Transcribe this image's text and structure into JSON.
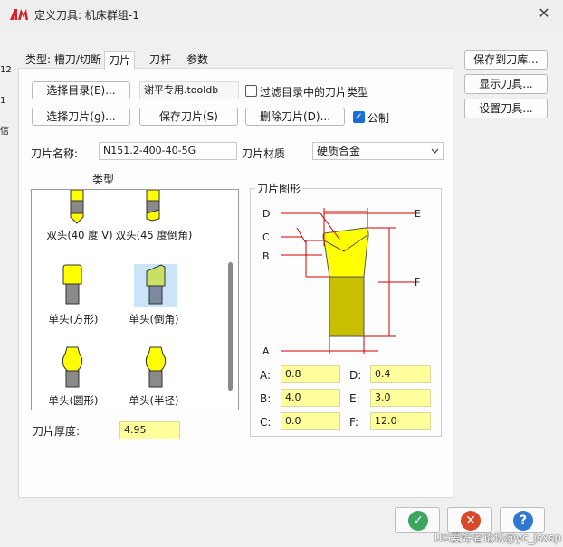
{
  "window": {
    "title": "定义刀具: 机床群组-1",
    "close_glyph": "✕"
  },
  "tabs": [
    {
      "label": "类型: 槽刀/切断",
      "active": false
    },
    {
      "label": "刀片",
      "active": true
    },
    {
      "label": "刀杆",
      "active": false
    },
    {
      "label": "参数",
      "active": false
    }
  ],
  "left_edge_fragments": [
    "12",
    "1",
    "信"
  ],
  "toolbar": {
    "select_dir_label": "选择目录(E)...",
    "dir_value": "谢平专用.tooldb",
    "filter_label": "过滤目录中的刀片类型",
    "filter_checked": false,
    "select_insert_label": "选择刀片(g)...",
    "save_insert_label": "保存刀片(S)",
    "delete_insert_label": "删除刀片(D)...",
    "metric_label": "公制",
    "metric_checked": true,
    "check_glyph": "✓"
  },
  "insert": {
    "name_label": "刀片名称:",
    "name_value": "N151.2-400-40-5G",
    "material_label": "刀片材质",
    "material_value": "硬质合金",
    "thickness_label": "刀片厚度:",
    "thickness_value": "4.95"
  },
  "type_list": {
    "title": "类型",
    "items": [
      {
        "label": "双头(40 度 V)",
        "selected": false
      },
      {
        "label": "双头(45 度倒角)",
        "selected": false
      },
      {
        "label": "单头(方形)",
        "selected": false
      },
      {
        "label": "单头(倒角)",
        "selected": true
      },
      {
        "label": "单头(圆形)",
        "selected": false
      },
      {
        "label": "单头(半径)",
        "selected": false
      }
    ]
  },
  "graphic": {
    "title": "刀片图形",
    "dim_letters": [
      "D",
      "C",
      "B",
      "A",
      "E",
      "F"
    ],
    "insert_color": "#ffff00",
    "shank_color": "#c8bf00",
    "dim_color": "#d40000"
  },
  "params": {
    "A": {
      "label": "A:",
      "value": "0.8"
    },
    "B": {
      "label": "B:",
      "value": "4.0"
    },
    "C": {
      "label": "C:",
      "value": "0.0"
    },
    "D": {
      "label": "D:",
      "value": "0.4"
    },
    "E": {
      "label": "E:",
      "value": "3.0"
    },
    "F": {
      "label": "F:",
      "value": "12.0"
    }
  },
  "side_buttons": {
    "save_to_lib": "保存到刀库...",
    "show_tool": "显示刀具...",
    "setup_tool": "设置刀具..."
  },
  "dialog_buttons": {
    "ok_glyph": "✓",
    "cancel_glyph": "✕",
    "help_glyph": "?",
    "ok_color": "#3aa660",
    "cancel_color": "#d9482b",
    "help_color": "#2f78d0"
  },
  "watermark": "UG爱好者论坛@yc_jsxsp"
}
